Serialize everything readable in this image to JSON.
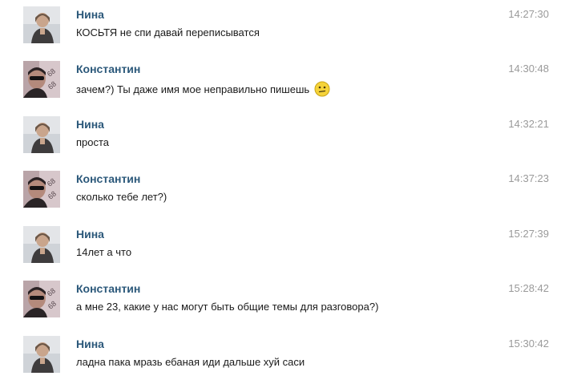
{
  "messages": [
    {
      "author": "Нина",
      "avatar": "nina-avatar",
      "text": "КОСЬТЯ не спи давай переписыватся",
      "time": "14:27:30",
      "emoji": null
    },
    {
      "author": "Константин",
      "avatar": "konstantin-avatar",
      "text": "зачем?) Ты даже имя мое неправильно пишешь",
      "time": "14:30:48",
      "emoji": "confused-smiley-icon"
    },
    {
      "author": "Нина",
      "avatar": "nina-avatar",
      "text": "проста",
      "time": "14:32:21",
      "emoji": null
    },
    {
      "author": "Константин",
      "avatar": "konstantin-avatar",
      "text": "сколько тебе лет?)",
      "time": "14:37:23",
      "emoji": null
    },
    {
      "author": "Нина",
      "avatar": "nina-avatar",
      "text": "14лет а что",
      "time": "15:27:39",
      "emoji": null
    },
    {
      "author": "Константин",
      "avatar": "konstantin-avatar",
      "text": "а мне 23, какие у нас могут быть общие темы для разговора?)",
      "time": "15:28:42",
      "emoji": null
    },
    {
      "author": "Нина",
      "avatar": "nina-avatar",
      "text": "ладна пака мразь ебаная иди дальше хуй саси",
      "time": "15:30:42",
      "emoji": null
    }
  ],
  "colors": {
    "author_name": "#2b587a",
    "message_text": "#1a1a1a",
    "timestamp": "#9a9a9a",
    "background": "#ffffff"
  }
}
